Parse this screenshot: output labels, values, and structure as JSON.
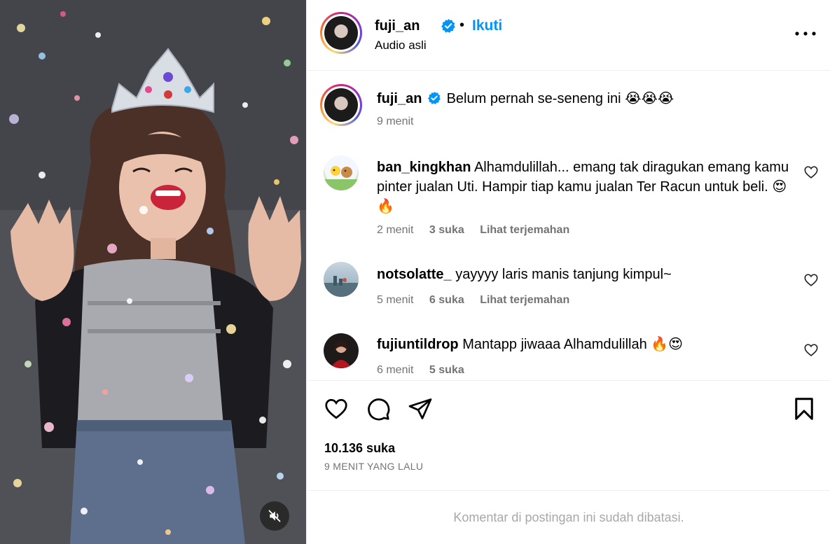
{
  "header": {
    "username": "fuji_an",
    "separator": "•",
    "follow_label": "Ikuti",
    "audio_label": "Audio asli"
  },
  "caption": {
    "username": "fuji_an",
    "text": "Belum pernah se-seneng ini 😭😭😭",
    "time": "9 menit"
  },
  "comments": [
    {
      "username": "ban_kingkhan",
      "text": "Alhamdulillah... emang tak diragukan emang kamu pinter jualan Uti. Hampir tiap kamu jualan Ter Racun untuk beli. 😍🔥",
      "time": "2 menit",
      "likes": "3 suka",
      "translate": "Lihat terjemahan"
    },
    {
      "username": "notsolatte_",
      "text": "yayyyy laris manis tanjung kimpul~",
      "time": "5 menit",
      "likes": "6 suka",
      "translate": "Lihat terjemahan"
    },
    {
      "username": "fujiuntildrop",
      "text": "Mantapp jiwaaa Alhamdulillah 🔥😍",
      "time": "6 menit",
      "likes": "5 suka"
    }
  ],
  "stats": {
    "likes": "10.136 suka",
    "time_ago": "9 MENIT YANG LALU"
  },
  "footer": {
    "restricted_text": "Komentar di postingan ini sudah dibatasi."
  },
  "colors": {
    "accent": "#0095f6",
    "verified": "#0095f6",
    "muted_text": "#737373",
    "restricted_text": "#a8a8a8"
  },
  "icons": [
    "muted-speaker-icon",
    "verified-badge-icon",
    "more-options-icon",
    "heart-icon",
    "comment-icon",
    "share-icon",
    "bookmark-icon"
  ]
}
